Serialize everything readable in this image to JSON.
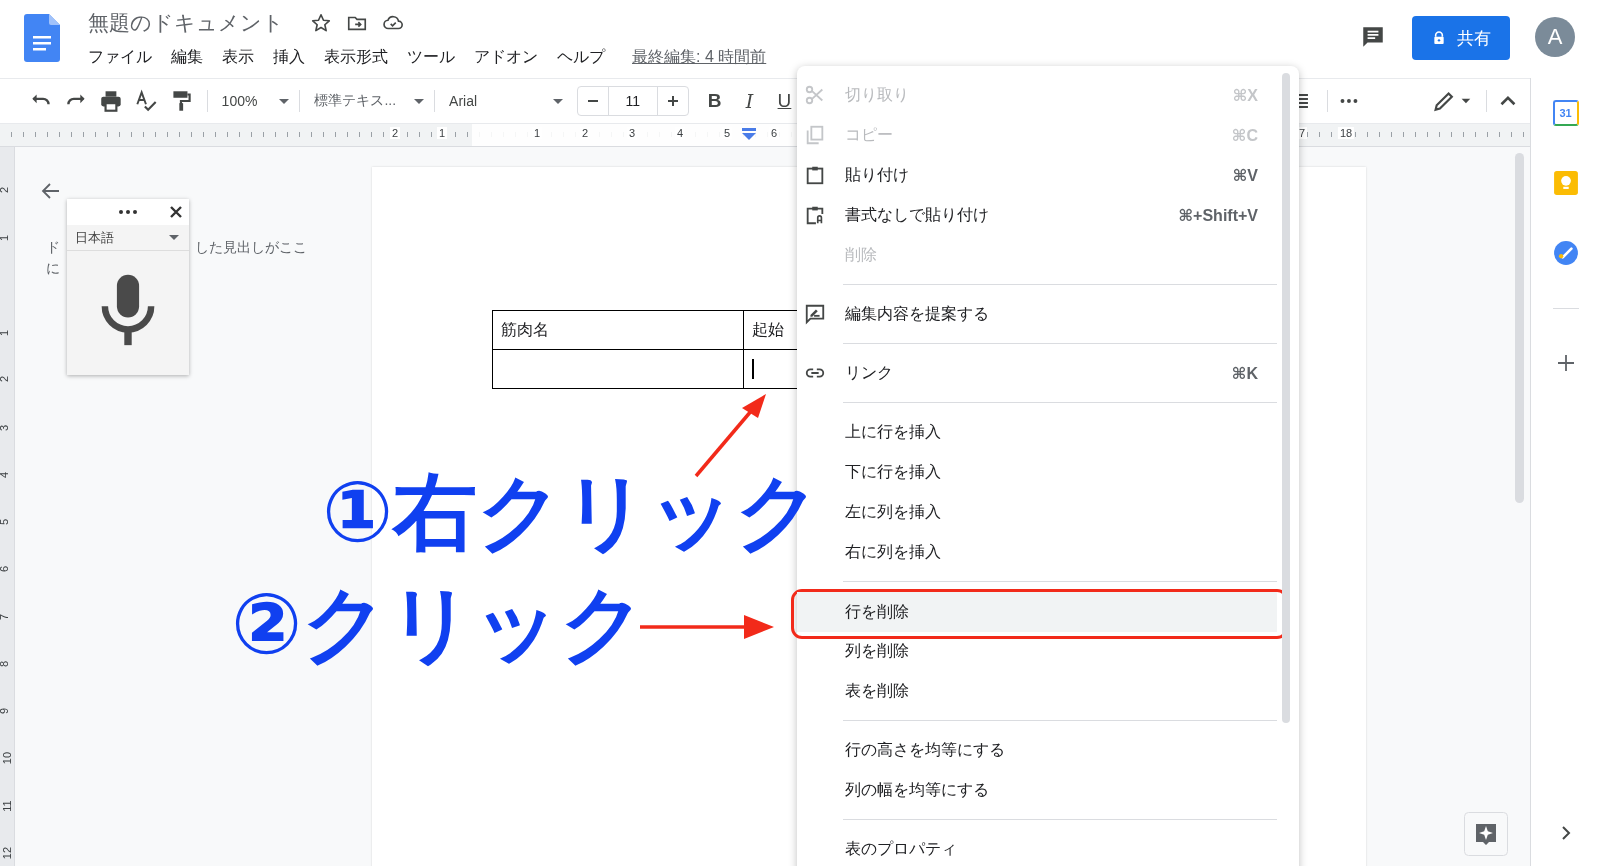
{
  "document": {
    "title": "無題のドキュメント",
    "starred": false
  },
  "menus": [
    {
      "label": "ファイル"
    },
    {
      "label": "編集"
    },
    {
      "label": "表示"
    },
    {
      "label": "挿入"
    },
    {
      "label": "表示形式"
    },
    {
      "label": "ツール"
    },
    {
      "label": "アドオン"
    },
    {
      "label": "ヘルプ"
    }
  ],
  "last_edit": "最終編集: 4 時間前",
  "share_button": {
    "label": "共有"
  },
  "account": {
    "initial": "A"
  },
  "toolbar": {
    "zoom": "100%",
    "paragraph_style": "標準テキス...",
    "font": "Arial",
    "font_size": "11",
    "format_buttons": [
      "B",
      "I",
      "U"
    ]
  },
  "horizontal_ruler": [
    "2",
    "1",
    "1",
    "2",
    "3",
    "4",
    "5",
    "6",
    "7",
    "18"
  ],
  "vertical_ruler": [
    "2",
    "1",
    "1",
    "2",
    "3",
    "4",
    "5",
    "6",
    "7",
    "8",
    "9",
    "10",
    "11",
    "12"
  ],
  "outline": {
    "lines": [
      "ド",
      "した見出しがここ",
      "に"
    ]
  },
  "voice_typing": {
    "language": "日本語"
  },
  "table": {
    "rows": [
      {
        "cells": [
          {
            "text": "筋肉名",
            "cursor": false
          },
          {
            "text": "起始",
            "cursor": false
          }
        ]
      },
      {
        "cells": [
          {
            "cursor": false
          },
          {
            "cursor": true
          }
        ]
      }
    ]
  },
  "context_menu": {
    "items": [
      {
        "kind": "cut",
        "label": "切り取り",
        "shortcut": "⌘X",
        "disabled": true,
        "selected": false
      },
      {
        "kind": "copy",
        "label": "コピー",
        "shortcut": "⌘C",
        "disabled": true,
        "selected": false
      },
      {
        "kind": "paste",
        "label": "貼り付け",
        "shortcut": "⌘V",
        "disabled": false,
        "selected": false
      },
      {
        "kind": "paste_plain",
        "label": "書式なしで貼り付け",
        "shortcut": "⌘+Shift+V",
        "disabled": false,
        "selected": false
      },
      {
        "kind": "plain",
        "label": "削除",
        "disabled": true,
        "selected": false
      },
      {
        "kind": "separator"
      },
      {
        "kind": "suggest",
        "label": "編集内容を提案する",
        "disabled": false,
        "selected": false
      },
      {
        "kind": "separator"
      },
      {
        "kind": "link",
        "label": "リンク",
        "shortcut": "⌘K",
        "disabled": false,
        "selected": false
      },
      {
        "kind": "separator"
      },
      {
        "kind": "plain",
        "label": "上に行を挿入",
        "disabled": false,
        "selected": false
      },
      {
        "kind": "plain",
        "label": "下に行を挿入",
        "disabled": false,
        "selected": false
      },
      {
        "kind": "plain",
        "label": "左に列を挿入",
        "disabled": false,
        "selected": false
      },
      {
        "kind": "plain",
        "label": "右に列を挿入",
        "disabled": false,
        "selected": false
      },
      {
        "kind": "separator"
      },
      {
        "kind": "plain",
        "label": "行を削除",
        "disabled": false,
        "selected": true
      },
      {
        "kind": "plain",
        "label": "列を削除",
        "disabled": false,
        "selected": false
      },
      {
        "kind": "plain",
        "label": "表を削除",
        "disabled": false,
        "selected": false
      },
      {
        "kind": "separator"
      },
      {
        "kind": "plain",
        "label": "行の高さを均等にする",
        "disabled": false,
        "selected": false
      },
      {
        "kind": "plain",
        "label": "列の幅を均等にする",
        "disabled": false,
        "selected": false
      },
      {
        "kind": "separator"
      },
      {
        "kind": "plain",
        "label": "表のプロパティ",
        "disabled": false,
        "selected": false
      }
    ]
  },
  "annotations": [
    {
      "text": "①右クリック"
    },
    {
      "text": "②クリック"
    }
  ],
  "side_panel": {
    "calendar_day": "31"
  }
}
